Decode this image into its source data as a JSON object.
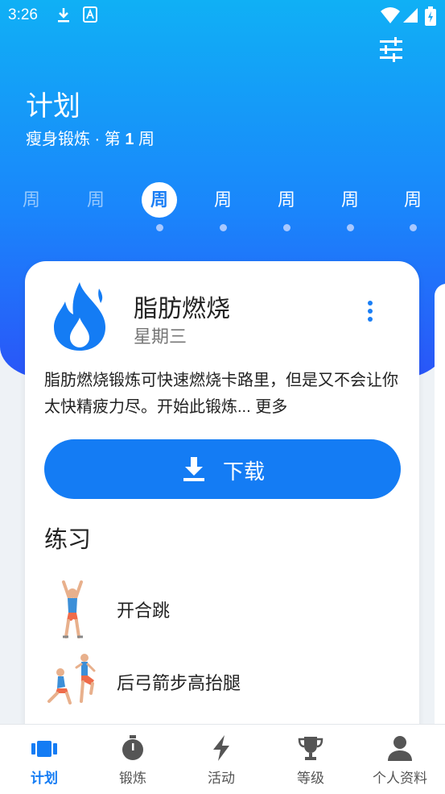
{
  "status_bar": {
    "time": "3:26"
  },
  "header": {
    "title": "计划",
    "subtitle_prefix": "瘦身锻炼 · 第 ",
    "subtitle_week_number": "1",
    "subtitle_suffix": " 周"
  },
  "weeks": [
    {
      "label": "周"
    },
    {
      "label": "周"
    },
    {
      "label": "周"
    },
    {
      "label": "周"
    },
    {
      "label": "周"
    },
    {
      "label": "周"
    },
    {
      "label": "周"
    }
  ],
  "workout": {
    "title": "脂肪燃烧",
    "day": "星期三",
    "description": "脂肪燃烧锻炼可快速燃烧卡路里，但是又不会让你太快精疲力尽。开始此锻炼...",
    "more_label": "更多",
    "download_label": "下载"
  },
  "exercises": {
    "section_title": "练习",
    "items": [
      {
        "name": "开合跳"
      },
      {
        "name": "后弓箭步高抬腿"
      }
    ]
  },
  "tabs": [
    {
      "label": "计划",
      "icon": "plan-icon"
    },
    {
      "label": "锻炼",
      "icon": "stopwatch-icon"
    },
    {
      "label": "活动",
      "icon": "lightning-icon"
    },
    {
      "label": "等级",
      "icon": "trophy-icon"
    },
    {
      "label": "个人资料",
      "icon": "person-icon"
    }
  ],
  "colors": {
    "primary": "#147cf4",
    "hero_top": "#10b0f5",
    "hero_bottom": "#2a55f8"
  }
}
